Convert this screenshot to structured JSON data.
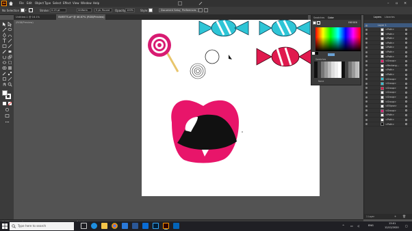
{
  "menu": {
    "logo": "Ai",
    "items": [
      "File",
      "Edit",
      "Object",
      "Type",
      "Select",
      "Effect",
      "View",
      "Window",
      "Help"
    ]
  },
  "control_bar": {
    "selection": "No Selection",
    "stroke_label": "Stroke:",
    "stroke_value": "0.25 pt",
    "uniform": "Uniform",
    "brush": "5 pt. Round",
    "opacity_label": "Opacity:",
    "opacity_value": "100%",
    "style_label": "Style:",
    "doc_setup": "Document Setup",
    "preferences": "Preferences"
  },
  "tabs": [
    "Untitled-1 @ 16.1% (RGB/Preview)",
    "SWEETS.ai* @ 46.67% (RGB/Preview)"
  ],
  "color_panel": {
    "tabs": [
      "Swatches",
      "Color"
    ],
    "hex": "E6E6E6",
    "swatches_label": "Swatches",
    "none_label": "None"
  },
  "layers_panel": {
    "tabs": [
      "Layers",
      "Libraries"
    ],
    "top_layer": "Layer 1",
    "rows": [
      "<Path>",
      "<Path>",
      "<Path>",
      "<Path>",
      "<Path>",
      "<Path>",
      "<Path>",
      "<Group>",
      "<Rectang...",
      "<Path>",
      "<Path>",
      "<Group>",
      "<Group>",
      "<Group>",
      "<Group>",
      "<Group>",
      "<Group>",
      "<Ellipse>",
      "<Group>",
      "<Path>",
      "<Path>",
      "<Path>"
    ],
    "footer": "1 Layer"
  },
  "status_bar": {
    "zoom": "46.67%",
    "page": "1",
    "tool": "Selection"
  },
  "taskbar": {
    "search_placeholder": "Type here to search",
    "lang": "ENG",
    "time": "13:01",
    "date": "12/12/2020"
  },
  "colors": {
    "lips": "#e8156a",
    "mouth": "#111111",
    "candy_cyan": "#2ec5d6",
    "candy_red": "#e01a4e",
    "lollipop_pink": "#d81b72",
    "stick": "#e8c56c",
    "accent": "#3d8ee6"
  },
  "icons": [
    "home-icon",
    "search-icon",
    "task-view-icon",
    "edge-icon",
    "file-explorer-icon",
    "chrome-icon",
    "store-icon",
    "word-icon",
    "mail-icon",
    "photoshop-icon",
    "illustrator-icon",
    "outlook-icon"
  ]
}
